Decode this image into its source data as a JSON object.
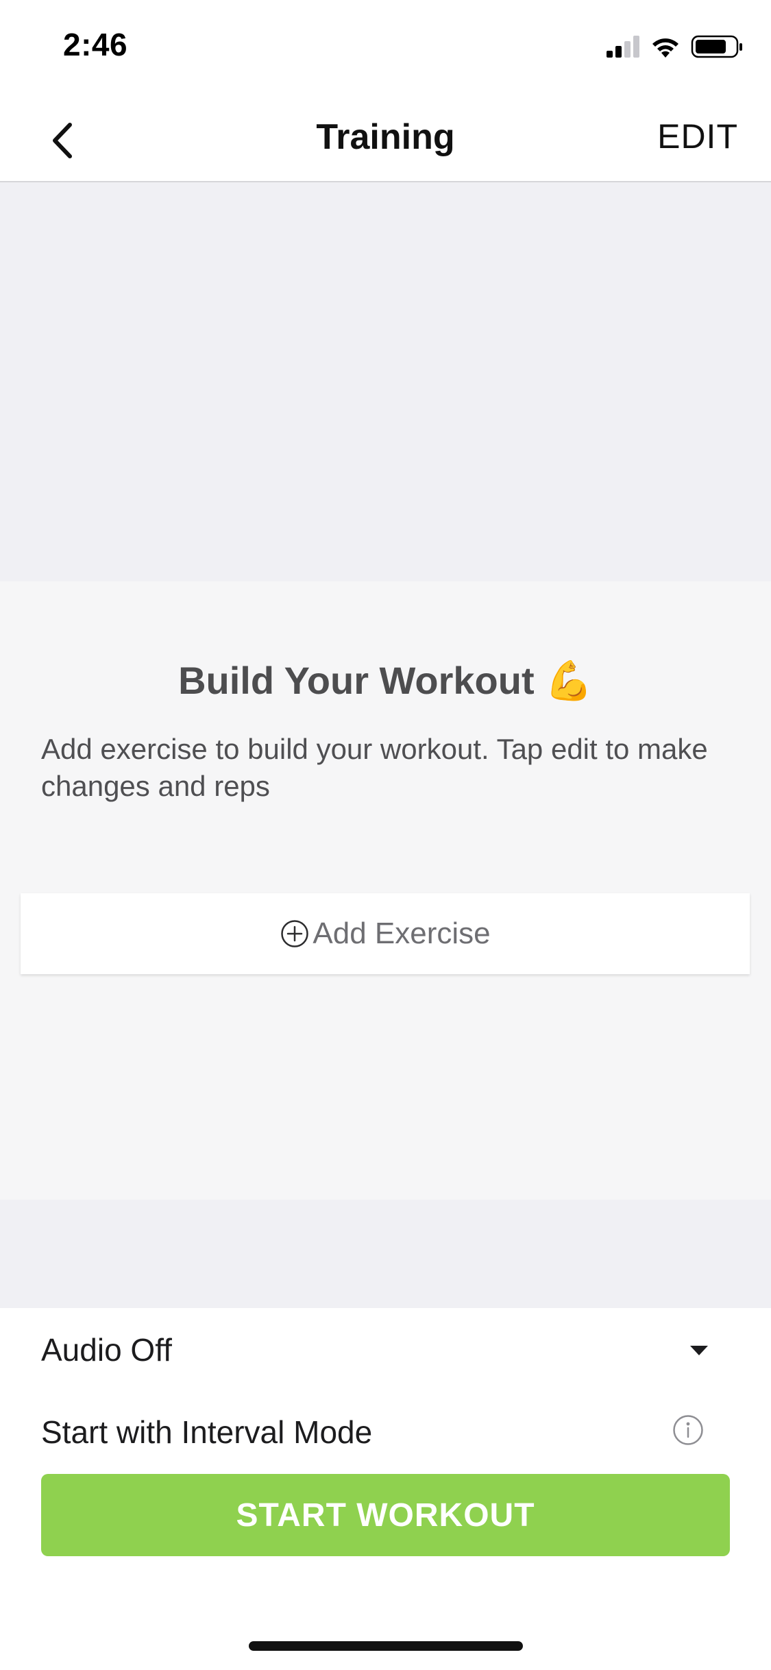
{
  "status_bar": {
    "time": "2:46",
    "icons": [
      "cellular-signal-icon",
      "wifi-icon",
      "battery-icon"
    ]
  },
  "nav": {
    "title": "Training",
    "edit_label": "EDIT",
    "back_icon": "chevron-left-icon"
  },
  "builder": {
    "title": "Build Your Workout",
    "title_emoji": "💪",
    "description": "Add exercise to build your workout. Tap edit to make changes and reps",
    "add_exercise_label": "Add Exercise",
    "add_icon": "plus-circle-icon"
  },
  "settings": {
    "audio_label": "Audio Off",
    "audio_icon": "caret-down-icon",
    "interval_label": "Start with Interval Mode",
    "interval_icon": "info-icon"
  },
  "start_button": {
    "label": "START WORKOUT"
  },
  "colors": {
    "accent_green": "#8fd14f",
    "band_gray": "#f0f0f4",
    "card_area_gray": "#f6f6f7"
  }
}
